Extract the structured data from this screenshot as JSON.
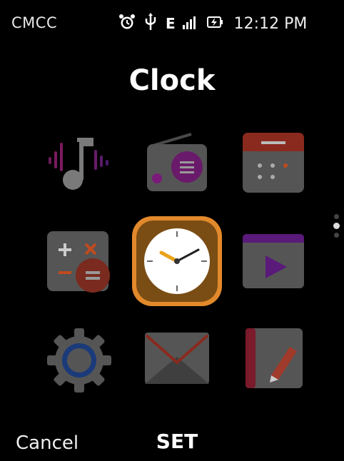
{
  "status_bar": {
    "carrier": "CMCC",
    "network": "E",
    "time": "12:12 PM",
    "icons": [
      "alarm-icon",
      "usb-icon",
      "network-type-icon",
      "signal-icon",
      "battery-charging-icon"
    ]
  },
  "title": "Clock",
  "apps": [
    {
      "name": "music",
      "icon": "music-icon"
    },
    {
      "name": "fm-radio",
      "icon": "radio-icon"
    },
    {
      "name": "calendar",
      "icon": "calendar-icon"
    },
    {
      "name": "calculator",
      "icon": "calculator-icon"
    },
    {
      "name": "clock",
      "icon": "clock-icon",
      "selected": true
    },
    {
      "name": "video",
      "icon": "video-icon"
    },
    {
      "name": "settings",
      "icon": "gear-icon"
    },
    {
      "name": "email",
      "icon": "mail-icon"
    },
    {
      "name": "notes",
      "icon": "note-icon"
    }
  ],
  "pager": {
    "pages": 3,
    "active": 1
  },
  "softkeys": {
    "left": "Cancel",
    "center": "SET"
  },
  "colors": {
    "selected_ring": "#e2892c",
    "accent_purple": "#6a1a7a",
    "accent_red": "#8a2a1e"
  }
}
